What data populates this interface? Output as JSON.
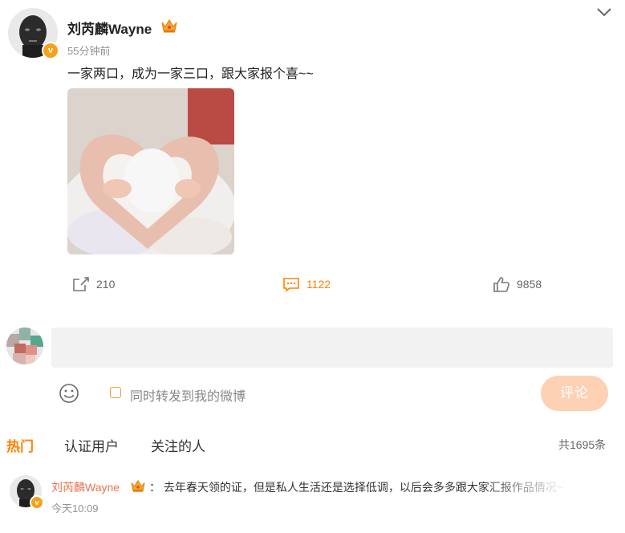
{
  "post": {
    "author": "刘芮麟Wayne",
    "time": "55分钟前",
    "text": "一家两口，成为一家三口，跟大家报个喜~~",
    "verified_mark": "v",
    "icons": [
      "crown-icon",
      "chevron-down-icon"
    ]
  },
  "actions": {
    "repost_count": "210",
    "comment_count": "1122",
    "like_count": "9858",
    "icons": [
      "repost-icon",
      "comment-icon",
      "like-icon"
    ]
  },
  "composer": {
    "input_value": "",
    "sync_label": "同时转发到我的微博",
    "submit_label": "评论",
    "icons": [
      "emoji-icon"
    ]
  },
  "tabs": [
    {
      "label": "热门",
      "active": true
    },
    {
      "label": "认证用户",
      "active": false
    },
    {
      "label": "关注的人",
      "active": false
    }
  ],
  "total_comments": "共1695条",
  "comments": [
    {
      "author": "刘芮麟Wayne",
      "text": "：  去年春天领的证，但是私人生活还是选择低调，以后会多多跟大家汇报作品情况~",
      "time": "今天10:09",
      "verified_mark": "v"
    }
  ],
  "colors": {
    "accent": "#ff8200",
    "comment_name": "#eb7350",
    "submit_button": "#fdd1b4",
    "badge": "#f7a11b"
  }
}
